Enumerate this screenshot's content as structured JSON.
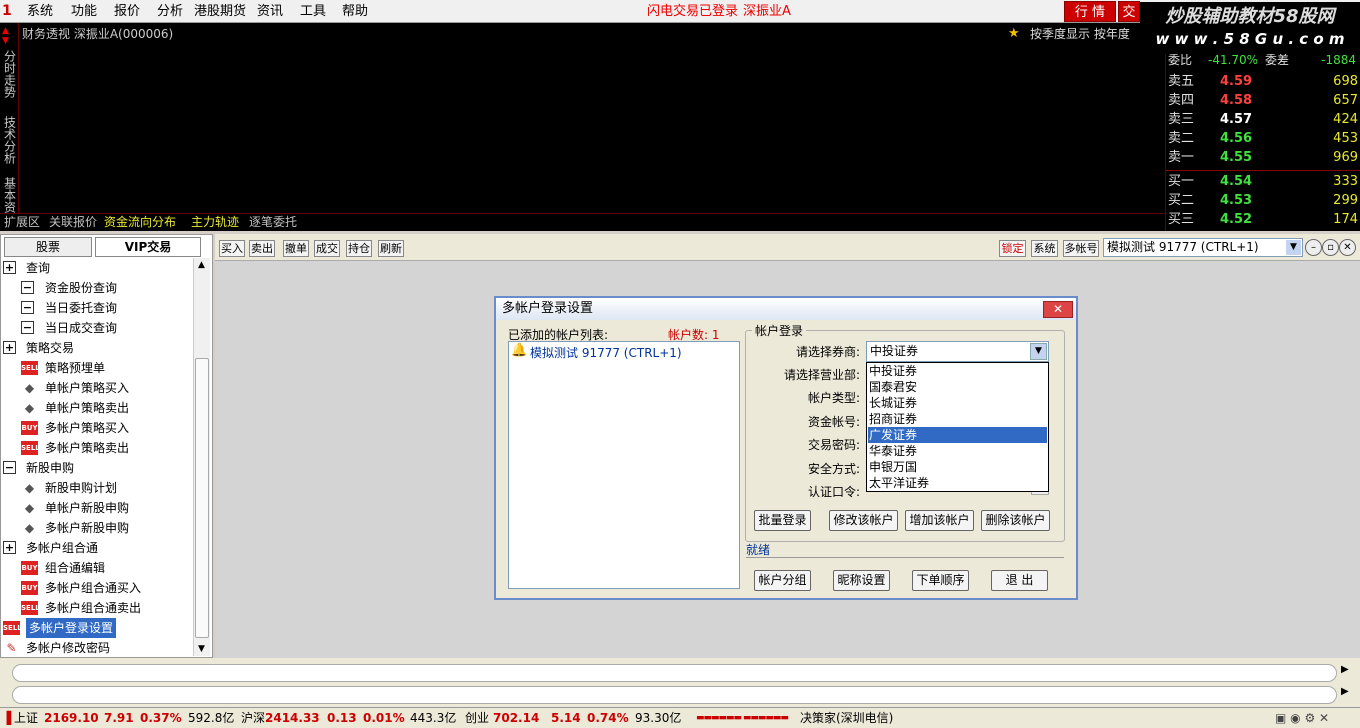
{
  "menu": [
    "系统",
    "功能",
    "报价",
    "分析",
    "港股期货",
    "资讯",
    "工具",
    "帮助"
  ],
  "header_status": {
    "login": "闪电交易已登录",
    "stock": "深振业A"
  },
  "top_buttons": {
    "quote": "行 情",
    "trade": "交"
  },
  "watermark": {
    "line1": "炒股辅助教材58股网",
    "line2": "w w w . 5 8 G u . c o m"
  },
  "left_vtabs": [
    "分时走势",
    "技术分析",
    "基本资"
  ],
  "quote_title": "财务透视  深振业A(000006)",
  "season_btn": "按季度显示   按年度",
  "bottom_tabs": [
    "扩展区",
    "关联报价",
    "资金流向分布",
    "主力轨迹",
    "逐笔委托"
  ],
  "orderbook": {
    "header": {
      "label": "委比",
      "value": "-41.70%",
      "label2": "委差",
      "value2": "-1884"
    },
    "rows": [
      {
        "label": "卖五",
        "price": "4.59",
        "vol": "698",
        "color": "#ff4040"
      },
      {
        "label": "卖四",
        "price": "4.58",
        "vol": "657",
        "color": "#ff4040"
      },
      {
        "label": "卖三",
        "price": "4.57",
        "vol": "424",
        "color": "#ffffff"
      },
      {
        "label": "卖二",
        "price": "4.56",
        "vol": "453",
        "color": "#40e040"
      },
      {
        "label": "卖一",
        "price": "4.55",
        "vol": "969",
        "color": "#40e040"
      },
      {
        "label": "买一",
        "price": "4.54",
        "vol": "333",
        "color": "#40e040"
      },
      {
        "label": "买二",
        "price": "4.53",
        "vol": "299",
        "color": "#40e040"
      },
      {
        "label": "买三",
        "price": "4.52",
        "vol": "174",
        "color": "#40e040"
      }
    ]
  },
  "left_tabs": {
    "stock": "股票",
    "vip": "VIP交易"
  },
  "tree": [
    {
      "type": "box",
      "mark": "+",
      "label": "查询",
      "indent": 0
    },
    {
      "type": "box",
      "mark": "−",
      "label": "资金股份查询",
      "indent": 1
    },
    {
      "type": "box",
      "mark": "−",
      "label": "当日委托查询",
      "indent": 1
    },
    {
      "type": "box",
      "mark": "−",
      "label": "当日成交查询",
      "indent": 1
    },
    {
      "type": "box",
      "mark": "+",
      "label": "策略交易",
      "indent": 0
    },
    {
      "type": "sell",
      "mark": "SELL",
      "label": "策略预埋单",
      "indent": 1
    },
    {
      "type": "diamond",
      "mark": "◆",
      "label": "单帐户策略买入",
      "indent": 1
    },
    {
      "type": "diamond",
      "mark": "◆",
      "label": "单帐户策略卖出",
      "indent": 1
    },
    {
      "type": "buy",
      "mark": "BUY",
      "label": "多帐户策略买入",
      "indent": 1
    },
    {
      "type": "sell",
      "mark": "SELL",
      "label": "多帐户策略卖出",
      "indent": 1
    },
    {
      "type": "box",
      "mark": "−",
      "label": "新股申购",
      "indent": 0
    },
    {
      "type": "diamond",
      "mark": "◆",
      "label": "新股申购计划",
      "indent": 1
    },
    {
      "type": "diamond",
      "mark": "◆",
      "label": "单帐户新股申购",
      "indent": 1
    },
    {
      "type": "diamond",
      "mark": "◆",
      "label": "多帐户新股申购",
      "indent": 1
    },
    {
      "type": "box",
      "mark": "+",
      "label": "多帐户组合通",
      "indent": 0
    },
    {
      "type": "buy",
      "mark": "BUY",
      "label": "组合通编辑",
      "indent": 1
    },
    {
      "type": "buy",
      "mark": "BUY",
      "label": "多帐户组合通买入",
      "indent": 1
    },
    {
      "type": "sell",
      "mark": "SELL",
      "label": "多帐户组合通卖出",
      "indent": 1
    },
    {
      "type": "sell",
      "mark": "SELL",
      "label": "多帐户登录设置",
      "indent": 0,
      "selected": true
    },
    {
      "type": "key",
      "mark": "✎",
      "label": "多帐户修改密码",
      "indent": 0
    }
  ],
  "toolbar": [
    "买入",
    "卖出",
    "撤单",
    "成交",
    "持仓",
    "刷新"
  ],
  "toolbar_right": {
    "lock": "锁定",
    "system": "系统",
    "multi": "多帐号",
    "account": "模拟测试 91777 (CTRL+1)"
  },
  "dialog": {
    "title": "多帐户登录设置",
    "list_label": "已添加的帐户列表:",
    "count_label": "帐户数: 1",
    "account_entry": "模拟测试 91777 (CTRL+1)",
    "group_label": "帐户登录",
    "fields": [
      "请选择券商:",
      "请选择营业部:",
      "帐户类型:",
      "资金帐号:",
      "交易密码:",
      "安全方式:",
      "认证口令:"
    ],
    "broker_selected": "中投证券",
    "broker_options": [
      "中投证券",
      "国泰君安",
      "长城证券",
      "招商证券",
      "广发证券",
      "华泰证券",
      "申银万国",
      "太平洋证券"
    ],
    "highlighted_option": 4,
    "buttons1": [
      "批量登录",
      "修改该帐户",
      "增加该帐户",
      "删除该帐户"
    ],
    "status": "就绪",
    "buttons2": [
      "帐户分组",
      "昵称设置",
      "下单顺序",
      "退 出"
    ]
  },
  "statusbar": {
    "sh_label": "上证",
    "sh_value": "2169.10",
    "sh_change": "7.91",
    "sh_pct": "0.37%",
    "sh_amt": "592.8亿",
    "sz_label": "沪深",
    "sz_value": "2414.33",
    "sz_change": "0.13",
    "sz_pct": "0.01%",
    "sz_amt": "443.3亿",
    "cy_label": "创业",
    "cy_value": "702.14",
    "cy_change": "5.14",
    "cy_pct": "0.74%",
    "cy_amt": "93.30亿",
    "broker": "决策家(深圳电信)"
  }
}
